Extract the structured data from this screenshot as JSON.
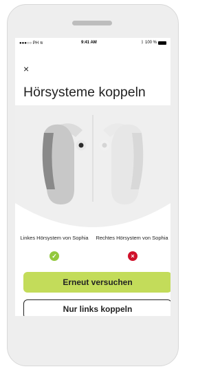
{
  "status_bar": {
    "carrier": "●●●○○ PH",
    "wifi_icon": "wifi-icon",
    "time": "9:41 AM",
    "bluetooth_icon": "bluetooth-icon",
    "battery": "100 %"
  },
  "header": {
    "close_icon": "close-icon",
    "close_glyph": "×",
    "title": "Hörsysteme koppeln"
  },
  "devices": {
    "left": {
      "label": "Linkes Hörsystem von Sophia",
      "status": "success",
      "status_glyph": "✓"
    },
    "right": {
      "label": "Rechtes Hörsystem von Sophia",
      "status": "error",
      "status_glyph": "×"
    }
  },
  "actions": {
    "retry_label": "Erneut versuchen",
    "left_only_label": "Nur links koppeln"
  },
  "colors": {
    "accent_green": "#c3dc5a",
    "success": "#93c83e",
    "error": "#d0112b"
  }
}
